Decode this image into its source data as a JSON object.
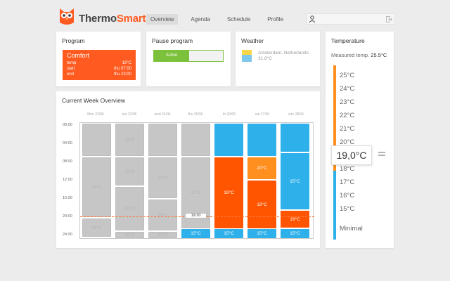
{
  "app": {
    "logo_text_a": "Thermo",
    "logo_text_b": "Smart",
    "brand_color": "#ff5a1f"
  },
  "nav": {
    "items": [
      "Overview",
      "Agenda",
      "Schedule",
      "Profile"
    ],
    "active": "Overview"
  },
  "header_icons": {
    "user": "user-icon",
    "logout": "logout-icon"
  },
  "program": {
    "title": "Program",
    "name": "Comfort",
    "rows": [
      {
        "label": "temp",
        "value": "19°C"
      },
      {
        "label": "start",
        "value": "thu 07:00"
      },
      {
        "label": "end",
        "value": "thu 23:00"
      }
    ]
  },
  "pause": {
    "title": "Pause program",
    "toggle_label": "Active"
  },
  "weather": {
    "title": "Weather",
    "location": "Amsterdam, Netherlands",
    "temp": "31.8°C",
    "icon": "sun-cloud-icon"
  },
  "temperature": {
    "title": "Temperature",
    "measured_label": "Measured temp.",
    "measured_value": "25.5°C",
    "scale": [
      "25°C",
      "24°C",
      "23°C",
      "22°C",
      "21°C",
      "20°C",
      "18°C",
      "17°C",
      "16°C",
      "15°C"
    ],
    "setpoint": "19,0°C",
    "minimal": "Minimal",
    "colors": {
      "warm": "#ff8f1f",
      "cool": "#2eb0ea"
    }
  },
  "week": {
    "title": "Current Week Overview",
    "days": [
      "Mon 22/06",
      "tue 23/06",
      "wed 24/06",
      "thu 25/06",
      "fri 26/06",
      "sat 27/06",
      "sun 28/06"
    ],
    "times": [
      "00:00",
      "04:00",
      "08:00",
      "12:00",
      "16:00",
      "20:00",
      "24:00"
    ],
    "now": "19:20",
    "block_labels": {
      "mon_a": "19°C",
      "mon_b": "19°C",
      "tue_a": "15°C",
      "tue_b": "19°C",
      "tue_c": "20°C",
      "tue_d": "15°C",
      "wed_a": "19°C",
      "wed_b": "20°C",
      "wed_c": "15°C",
      "thu_a": "19°C",
      "thu_b": "15°C",
      "fri_a": "19°C",
      "fri_b": "15°C",
      "sat_a": "20°C",
      "sat_b": "19°C",
      "sat_c": "15°C",
      "sun_a": "15°C",
      "sun_b": "19°C",
      "sun_c": "15°C"
    }
  }
}
